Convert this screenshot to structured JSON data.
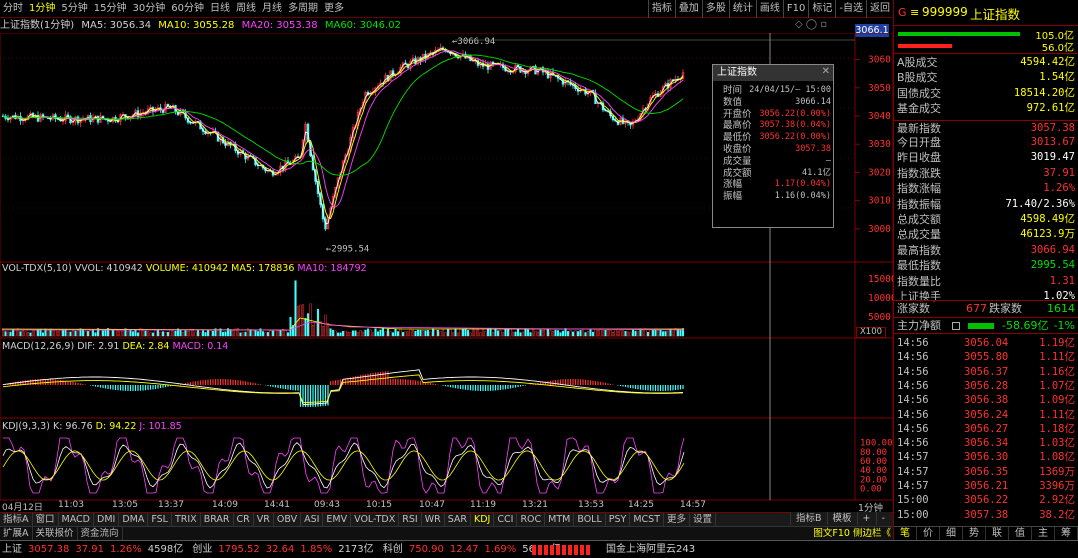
{
  "toolbar": {
    "periods": [
      "分时",
      "1分钟",
      "5分钟",
      "15分钟",
      "30分钟",
      "60分钟",
      "日线",
      "周线",
      "月线",
      "多周期",
      "更多"
    ],
    "selected": 1,
    "right": [
      "指标",
      "叠加",
      "多股",
      "统计",
      "画线",
      "F10",
      "标记",
      "-自选",
      "返回"
    ]
  },
  "title": {
    "name": "上证指数(1分钟)",
    "ma5": "MA5: 3056.34",
    "ma10": "MA10: 3055.28",
    "ma20": "MA20: 3053.38",
    "ma60": "MA60: 3046.02",
    "price_box": "3066.1"
  },
  "vol_label": {
    "name": "VOL-TDX(5,10)",
    "vvol": "VVOL: 410942",
    "volume": "VOLUME: 410942",
    "ma5": "MA5: 178836",
    "ma10": "MA10: 184792",
    "unit": "X100"
  },
  "macd_label": {
    "name": "MACD(12,26,9)",
    "dif": "DIF: 2.91",
    "dea": "DEA: 2.84",
    "macd": "MACD: 0.14"
  },
  "kdj_label": {
    "name": "KDJ(9,3,3)",
    "k": "K: 96.76",
    "d": "D: 94.22",
    "j": "J: 101.85"
  },
  "annotations": {
    "high": "3066.94",
    "low": "2995.54"
  },
  "infobox": {
    "title": "上证指数",
    "rows": [
      {
        "k": "时间",
        "v": "24/04/15/— 15:00",
        "c": "#c0c0c0"
      },
      {
        "k": "数值",
        "v": "3066.14",
        "c": "#c0c0c0"
      },
      {
        "k": "开盘价",
        "v": "3056.22(0.00%)",
        "c": "#ff3030"
      },
      {
        "k": "最高价",
        "v": "3057.38(0.04%)",
        "c": "#ff3030"
      },
      {
        "k": "最低价",
        "v": "3056.22(0.00%)",
        "c": "#ff3030"
      },
      {
        "k": "收盘价",
        "v": "3057.38",
        "c": "#ff3030"
      },
      {
        "k": "成交量",
        "v": "—",
        "c": "#c0c0c0"
      },
      {
        "k": "成交额",
        "v": "41.1亿",
        "c": "#c0c0c0"
      },
      {
        "k": "涨幅",
        "v": "1.17(0.04%)",
        "c": "#ff3030"
      },
      {
        "k": "振幅",
        "v": "1.16(0.04%)",
        "c": "#c0c0c0"
      }
    ]
  },
  "xaxis": [
    "04月12日",
    "11:03",
    "13:05",
    "13:37",
    "14:09",
    "14:41",
    "09:43",
    "10:15",
    "10:47",
    "11:19",
    "13:21",
    "13:53",
    "14:25",
    "14:57"
  ],
  "xaxis_right": "1分钟",
  "chart_data": [
    {
      "type": "candlestick",
      "title": "上证指数(1分钟)",
      "ylim": [
        2990,
        3068
      ],
      "yticks": [
        3000,
        3010,
        3020,
        3030,
        3040,
        3050,
        3060
      ],
      "annotations": [
        {
          "label": "3066.94",
          "value": 3066.94
        },
        {
          "label": "2995.54",
          "value": 2995.54
        }
      ],
      "series": [
        {
          "name": "MA5",
          "value": 3056.34,
          "color": "#ffffff"
        },
        {
          "name": "MA10",
          "value": 3055.28,
          "color": "#ffff00"
        },
        {
          "name": "MA20",
          "value": 3053.38,
          "color": "#ff40ff"
        },
        {
          "name": "MA60",
          "value": 3046.02,
          "color": "#00e000"
        }
      ],
      "x": [
        "04月12日",
        "11:03",
        "13:05",
        "13:37",
        "14:09",
        "14:41",
        "09:43",
        "10:15",
        "10:47",
        "11:19",
        "13:21",
        "13:53",
        "14:25",
        "14:57"
      ],
      "close": [
        3040,
        3039,
        3041,
        3043,
        3038,
        3020,
        3036,
        3002,
        3050,
        3058,
        3063,
        3057,
        3056,
        3045,
        3050,
        3057
      ],
      "open": [
        3039,
        3040,
        3040,
        3042,
        3040,
        3025,
        3038,
        3010,
        3045,
        3055,
        3061,
        3058,
        3057,
        3048,
        3047,
        3055
      ],
      "high": [
        3042,
        3042,
        3043,
        3045,
        3041,
        3027,
        3040,
        3012,
        3052,
        3060,
        3066.94,
        3060,
        3059,
        3050,
        3052,
        3058
      ],
      "low": [
        3037,
        3037,
        3039,
        3040,
        3036,
        3017,
        3033,
        2995.54,
        3043,
        3054,
        3058,
        3054,
        3053,
        3040,
        3045,
        3053
      ]
    },
    {
      "type": "bar",
      "title": "VOL-TDX(5,10)",
      "ylim": [
        0,
        16000
      ],
      "yticks": [
        5000,
        10000,
        15000
      ],
      "series": [
        {
          "name": "VOLUME",
          "value": 410942
        },
        {
          "name": "MA5",
          "value": 178836
        },
        {
          "name": "MA10",
          "value": 184792
        }
      ]
    },
    {
      "type": "line",
      "title": "MACD(12,26,9)",
      "ylim": [
        -6,
        6
      ],
      "series": [
        {
          "name": "DIF",
          "value": 2.91,
          "color": "#ffffff"
        },
        {
          "name": "DEA",
          "value": 2.84,
          "color": "#ffff00"
        },
        {
          "name": "MACD",
          "value": 0.14,
          "color": "#ff40ff"
        }
      ]
    },
    {
      "type": "line",
      "title": "KDJ(9,3,3)",
      "ylim": [
        -10,
        110
      ],
      "yticks": [
        0,
        20,
        40,
        60,
        80,
        100
      ],
      "series": [
        {
          "name": "K",
          "value": 96.76,
          "color": "#ffffff"
        },
        {
          "name": "D",
          "value": 94.22,
          "color": "#ffff00"
        },
        {
          "name": "J",
          "value": 101.85,
          "color": "#ff40ff"
        }
      ]
    }
  ],
  "vol_ticks": [
    "15000",
    "10000",
    "5000"
  ],
  "macd_ticks": [],
  "kdj_ticks": [
    "100.00",
    "80.00",
    "60.00",
    "40.00",
    "20.00",
    "0.00"
  ],
  "price_ticks": [
    "3060",
    "3050",
    "3040",
    "3030",
    "3020",
    "3010",
    "3000"
  ],
  "bottom_tabs": [
    "指标A",
    "窗口",
    "MACD",
    "DMI",
    "DMA",
    "FSL",
    "TRIX",
    "BRAR",
    "CR",
    "VR",
    "OBV",
    "ASI",
    "EMV",
    "VOL-TDX",
    "RSI",
    "WR",
    "SAR",
    "KDJ",
    "CCI",
    "ROC",
    "MTM",
    "BOLL",
    "PSY",
    "MCST",
    "更多",
    "设置"
  ],
  "bottom_selected": "KDJ",
  "bottom_right": [
    "指标B",
    "模板",
    "+",
    "-"
  ],
  "sub_tabs": [
    "扩展A",
    "关联报价",
    "资金流向"
  ],
  "sub_right": "图文F10 侧边栏《",
  "right": {
    "header_g": "G",
    "header_code": "999999",
    "header_name": "上证指数",
    "bar_vals": [
      "105.0亿",
      "56.0亿"
    ],
    "stats": [
      {
        "k": "A股成交",
        "v": "4594.42亿",
        "c": "#ffff00"
      },
      {
        "k": "B股成交",
        "v": "1.54亿",
        "c": "#ffff00"
      },
      {
        "k": "国债成交",
        "v": "18514.20亿",
        "c": "#ffff00"
      },
      {
        "k": "基金成交",
        "v": "972.61亿",
        "c": "#ffff00"
      },
      {
        "k": "最新指数",
        "v": "3057.38",
        "c": "#ff3030"
      },
      {
        "k": "今日开盘",
        "v": "3013.67",
        "c": "#ff3030"
      },
      {
        "k": "昨日收盘",
        "v": "3019.47",
        "c": "#ffffff"
      },
      {
        "k": "指数涨跌",
        "v": "37.91",
        "c": "#ff3030"
      },
      {
        "k": "指数涨幅",
        "v": "1.26%",
        "c": "#ff3030"
      },
      {
        "k": "指数振幅",
        "v": "71.40/2.36%",
        "c": "#ffffff"
      },
      {
        "k": "总成交额",
        "v": "4598.49亿",
        "c": "#ffff00"
      },
      {
        "k": "总成交量",
        "v": "46123.9万",
        "c": "#ffff00"
      },
      {
        "k": "最高指数",
        "v": "3066.94",
        "c": "#ff3030"
      },
      {
        "k": "最低指数",
        "v": "2995.54",
        "c": "#00e000"
      },
      {
        "k": "指数量比",
        "v": "1.31",
        "c": "#ff3030"
      },
      {
        "k": "上证换手",
        "v": "1.02%",
        "c": "#ffffff"
      }
    ],
    "updown": {
      "up_label": "涨家数",
      "up": "677",
      "down_label": "跌家数",
      "down": "1614"
    },
    "netflow": {
      "label": "主力净额",
      "v1": "-58.69亿",
      "v2": "-1%"
    },
    "ticks": [
      {
        "t": "14:56",
        "p": "3056.04",
        "a": "1.19亿"
      },
      {
        "t": "14:56",
        "p": "3055.80",
        "a": "1.11亿"
      },
      {
        "t": "14:56",
        "p": "3056.37",
        "a": "1.16亿"
      },
      {
        "t": "14:56",
        "p": "3056.28",
        "a": "1.07亿"
      },
      {
        "t": "14:56",
        "p": "3056.38",
        "a": "1.09亿"
      },
      {
        "t": "14:56",
        "p": "3056.24",
        "a": "1.11亿"
      },
      {
        "t": "14:56",
        "p": "3056.27",
        "a": "1.18亿"
      },
      {
        "t": "14:56",
        "p": "3056.34",
        "a": "1.03亿"
      },
      {
        "t": "14:57",
        "p": "3056.30",
        "a": "1.08亿"
      },
      {
        "t": "14:57",
        "p": "3056.35",
        "a": "1369万"
      },
      {
        "t": "14:57",
        "p": "3056.21",
        "a": "3396万"
      },
      {
        "t": "15:00",
        "p": "3056.22",
        "a": "2.92亿"
      },
      {
        "t": "15:00",
        "p": "3057.38",
        "a": "38.2亿"
      }
    ],
    "bottom_tabs": [
      "笔",
      "价",
      "细",
      "势",
      "联",
      "值",
      "主",
      "筹"
    ]
  },
  "status": {
    "sh_label": "上证",
    "sh_val": "3057.38",
    "sh_chg": "37.91",
    "sh_pct": "1.26%",
    "sh_amt": "4598亿",
    "cy_label": "创业",
    "cy_val": "1795.52",
    "cy_chg": "32.64",
    "cy_pct": "1.85%",
    "cy_amt": "2173亿",
    "kc_label": "科创",
    "kc_val": "750.90",
    "kc_chg": "12.47",
    "kc_pct": "1.69%",
    "kc_amt": "569.3亿",
    "server": "国金上海阿里云243"
  }
}
